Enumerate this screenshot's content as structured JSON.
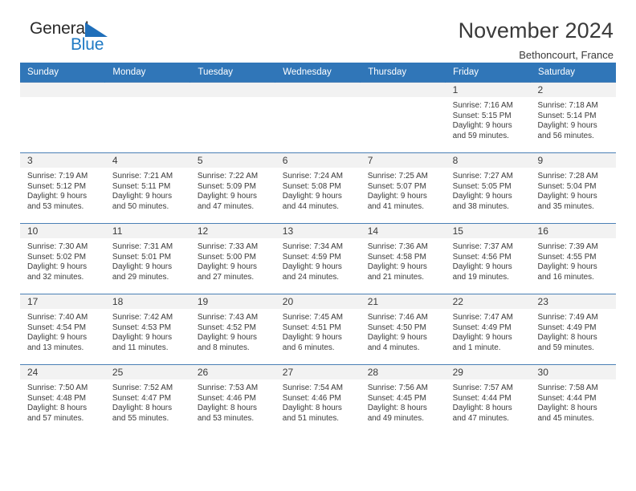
{
  "brand": {
    "name_top": "General",
    "name_bottom": "Blue",
    "accent_color": "#1f7ac4"
  },
  "header": {
    "title": "November 2024",
    "subtitle": "Bethoncourt, France",
    "header_bg_color": "#3076b8"
  },
  "weekday_headers": [
    "Sunday",
    "Monday",
    "Tuesday",
    "Wednesday",
    "Thursday",
    "Friday",
    "Saturday"
  ],
  "labels": {
    "sunrise": "Sunrise:",
    "sunset": "Sunset:",
    "daylight": "Daylight:"
  },
  "weeks": [
    [
      {
        "day": "",
        "sunrise": "",
        "sunset": "",
        "daylight_line1": "",
        "daylight_line2": "",
        "empty": true
      },
      {
        "day": "",
        "sunrise": "",
        "sunset": "",
        "daylight_line1": "",
        "daylight_line2": "",
        "empty": true
      },
      {
        "day": "",
        "sunrise": "",
        "sunset": "",
        "daylight_line1": "",
        "daylight_line2": "",
        "empty": true
      },
      {
        "day": "",
        "sunrise": "",
        "sunset": "",
        "daylight_line1": "",
        "daylight_line2": "",
        "empty": true
      },
      {
        "day": "",
        "sunrise": "",
        "sunset": "",
        "daylight_line1": "",
        "daylight_line2": "",
        "empty": true
      },
      {
        "day": "1",
        "sunrise": "Sunrise: 7:16 AM",
        "sunset": "Sunset: 5:15 PM",
        "daylight_line1": "Daylight: 9 hours",
        "daylight_line2": "and 59 minutes.",
        "empty": false
      },
      {
        "day": "2",
        "sunrise": "Sunrise: 7:18 AM",
        "sunset": "Sunset: 5:14 PM",
        "daylight_line1": "Daylight: 9 hours",
        "daylight_line2": "and 56 minutes.",
        "empty": false
      }
    ],
    [
      {
        "day": "3",
        "sunrise": "Sunrise: 7:19 AM",
        "sunset": "Sunset: 5:12 PM",
        "daylight_line1": "Daylight: 9 hours",
        "daylight_line2": "and 53 minutes.",
        "empty": false
      },
      {
        "day": "4",
        "sunrise": "Sunrise: 7:21 AM",
        "sunset": "Sunset: 5:11 PM",
        "daylight_line1": "Daylight: 9 hours",
        "daylight_line2": "and 50 minutes.",
        "empty": false
      },
      {
        "day": "5",
        "sunrise": "Sunrise: 7:22 AM",
        "sunset": "Sunset: 5:09 PM",
        "daylight_line1": "Daylight: 9 hours",
        "daylight_line2": "and 47 minutes.",
        "empty": false
      },
      {
        "day": "6",
        "sunrise": "Sunrise: 7:24 AM",
        "sunset": "Sunset: 5:08 PM",
        "daylight_line1": "Daylight: 9 hours",
        "daylight_line2": "and 44 minutes.",
        "empty": false
      },
      {
        "day": "7",
        "sunrise": "Sunrise: 7:25 AM",
        "sunset": "Sunset: 5:07 PM",
        "daylight_line1": "Daylight: 9 hours",
        "daylight_line2": "and 41 minutes.",
        "empty": false
      },
      {
        "day": "8",
        "sunrise": "Sunrise: 7:27 AM",
        "sunset": "Sunset: 5:05 PM",
        "daylight_line1": "Daylight: 9 hours",
        "daylight_line2": "and 38 minutes.",
        "empty": false
      },
      {
        "day": "9",
        "sunrise": "Sunrise: 7:28 AM",
        "sunset": "Sunset: 5:04 PM",
        "daylight_line1": "Daylight: 9 hours",
        "daylight_line2": "and 35 minutes.",
        "empty": false
      }
    ],
    [
      {
        "day": "10",
        "sunrise": "Sunrise: 7:30 AM",
        "sunset": "Sunset: 5:02 PM",
        "daylight_line1": "Daylight: 9 hours",
        "daylight_line2": "and 32 minutes.",
        "empty": false
      },
      {
        "day": "11",
        "sunrise": "Sunrise: 7:31 AM",
        "sunset": "Sunset: 5:01 PM",
        "daylight_line1": "Daylight: 9 hours",
        "daylight_line2": "and 29 minutes.",
        "empty": false
      },
      {
        "day": "12",
        "sunrise": "Sunrise: 7:33 AM",
        "sunset": "Sunset: 5:00 PM",
        "daylight_line1": "Daylight: 9 hours",
        "daylight_line2": "and 27 minutes.",
        "empty": false
      },
      {
        "day": "13",
        "sunrise": "Sunrise: 7:34 AM",
        "sunset": "Sunset: 4:59 PM",
        "daylight_line1": "Daylight: 9 hours",
        "daylight_line2": "and 24 minutes.",
        "empty": false
      },
      {
        "day": "14",
        "sunrise": "Sunrise: 7:36 AM",
        "sunset": "Sunset: 4:58 PM",
        "daylight_line1": "Daylight: 9 hours",
        "daylight_line2": "and 21 minutes.",
        "empty": false
      },
      {
        "day": "15",
        "sunrise": "Sunrise: 7:37 AM",
        "sunset": "Sunset: 4:56 PM",
        "daylight_line1": "Daylight: 9 hours",
        "daylight_line2": "and 19 minutes.",
        "empty": false
      },
      {
        "day": "16",
        "sunrise": "Sunrise: 7:39 AM",
        "sunset": "Sunset: 4:55 PM",
        "daylight_line1": "Daylight: 9 hours",
        "daylight_line2": "and 16 minutes.",
        "empty": false
      }
    ],
    [
      {
        "day": "17",
        "sunrise": "Sunrise: 7:40 AM",
        "sunset": "Sunset: 4:54 PM",
        "daylight_line1": "Daylight: 9 hours",
        "daylight_line2": "and 13 minutes.",
        "empty": false
      },
      {
        "day": "18",
        "sunrise": "Sunrise: 7:42 AM",
        "sunset": "Sunset: 4:53 PM",
        "daylight_line1": "Daylight: 9 hours",
        "daylight_line2": "and 11 minutes.",
        "empty": false
      },
      {
        "day": "19",
        "sunrise": "Sunrise: 7:43 AM",
        "sunset": "Sunset: 4:52 PM",
        "daylight_line1": "Daylight: 9 hours",
        "daylight_line2": "and 8 minutes.",
        "empty": false
      },
      {
        "day": "20",
        "sunrise": "Sunrise: 7:45 AM",
        "sunset": "Sunset: 4:51 PM",
        "daylight_line1": "Daylight: 9 hours",
        "daylight_line2": "and 6 minutes.",
        "empty": false
      },
      {
        "day": "21",
        "sunrise": "Sunrise: 7:46 AM",
        "sunset": "Sunset: 4:50 PM",
        "daylight_line1": "Daylight: 9 hours",
        "daylight_line2": "and 4 minutes.",
        "empty": false
      },
      {
        "day": "22",
        "sunrise": "Sunrise: 7:47 AM",
        "sunset": "Sunset: 4:49 PM",
        "daylight_line1": "Daylight: 9 hours",
        "daylight_line2": "and 1 minute.",
        "empty": false
      },
      {
        "day": "23",
        "sunrise": "Sunrise: 7:49 AM",
        "sunset": "Sunset: 4:49 PM",
        "daylight_line1": "Daylight: 8 hours",
        "daylight_line2": "and 59 minutes.",
        "empty": false
      }
    ],
    [
      {
        "day": "24",
        "sunrise": "Sunrise: 7:50 AM",
        "sunset": "Sunset: 4:48 PM",
        "daylight_line1": "Daylight: 8 hours",
        "daylight_line2": "and 57 minutes.",
        "empty": false
      },
      {
        "day": "25",
        "sunrise": "Sunrise: 7:52 AM",
        "sunset": "Sunset: 4:47 PM",
        "daylight_line1": "Daylight: 8 hours",
        "daylight_line2": "and 55 minutes.",
        "empty": false
      },
      {
        "day": "26",
        "sunrise": "Sunrise: 7:53 AM",
        "sunset": "Sunset: 4:46 PM",
        "daylight_line1": "Daylight: 8 hours",
        "daylight_line2": "and 53 minutes.",
        "empty": false
      },
      {
        "day": "27",
        "sunrise": "Sunrise: 7:54 AM",
        "sunset": "Sunset: 4:46 PM",
        "daylight_line1": "Daylight: 8 hours",
        "daylight_line2": "and 51 minutes.",
        "empty": false
      },
      {
        "day": "28",
        "sunrise": "Sunrise: 7:56 AM",
        "sunset": "Sunset: 4:45 PM",
        "daylight_line1": "Daylight: 8 hours",
        "daylight_line2": "and 49 minutes.",
        "empty": false
      },
      {
        "day": "29",
        "sunrise": "Sunrise: 7:57 AM",
        "sunset": "Sunset: 4:44 PM",
        "daylight_line1": "Daylight: 8 hours",
        "daylight_line2": "and 47 minutes.",
        "empty": false
      },
      {
        "day": "30",
        "sunrise": "Sunrise: 7:58 AM",
        "sunset": "Sunset: 4:44 PM",
        "daylight_line1": "Daylight: 8 hours",
        "daylight_line2": "and 45 minutes.",
        "empty": false
      }
    ]
  ]
}
